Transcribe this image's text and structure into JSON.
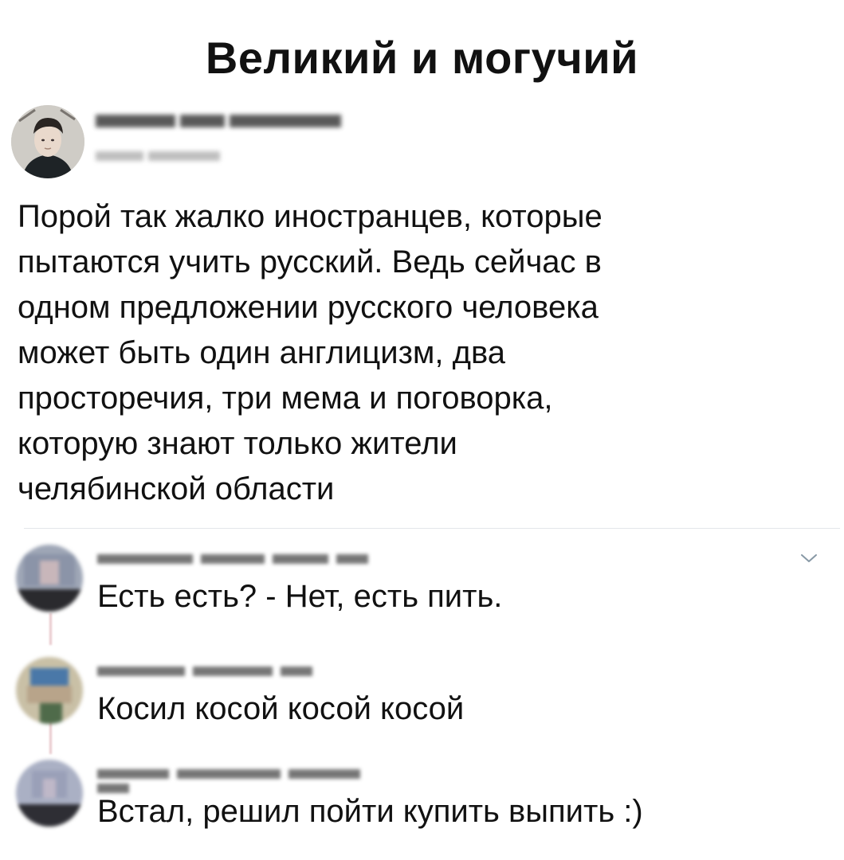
{
  "title": "Великий и могучий",
  "post": {
    "avatar_icon": "user-avatar-photo",
    "text": "Порой так жалко иностранцев, которые\nпытаются учить русский.  Ведь сейчас в\nодном предложении русского человека\nможет быть один англицизм, два\nпросторечия, три мема и поговорка,\nкоторую знают только жители\nчелябинской области"
  },
  "menu_icon": "chevron-down-icon",
  "comments": [
    {
      "avatar_icon": "user-avatar-blurred",
      "text": "Есть есть? - Нет, есть пить."
    },
    {
      "avatar_icon": "user-avatar-blurred",
      "text": "Косил косой косой косой"
    },
    {
      "avatar_icon": "user-avatar-blurred",
      "text": "Встал, решил пойти купить выпить :)"
    }
  ],
  "colors": {
    "text": "#111111",
    "divider": "#e3e6ea",
    "chevron": "#8899a6",
    "thread": "#e8c8cc"
  }
}
